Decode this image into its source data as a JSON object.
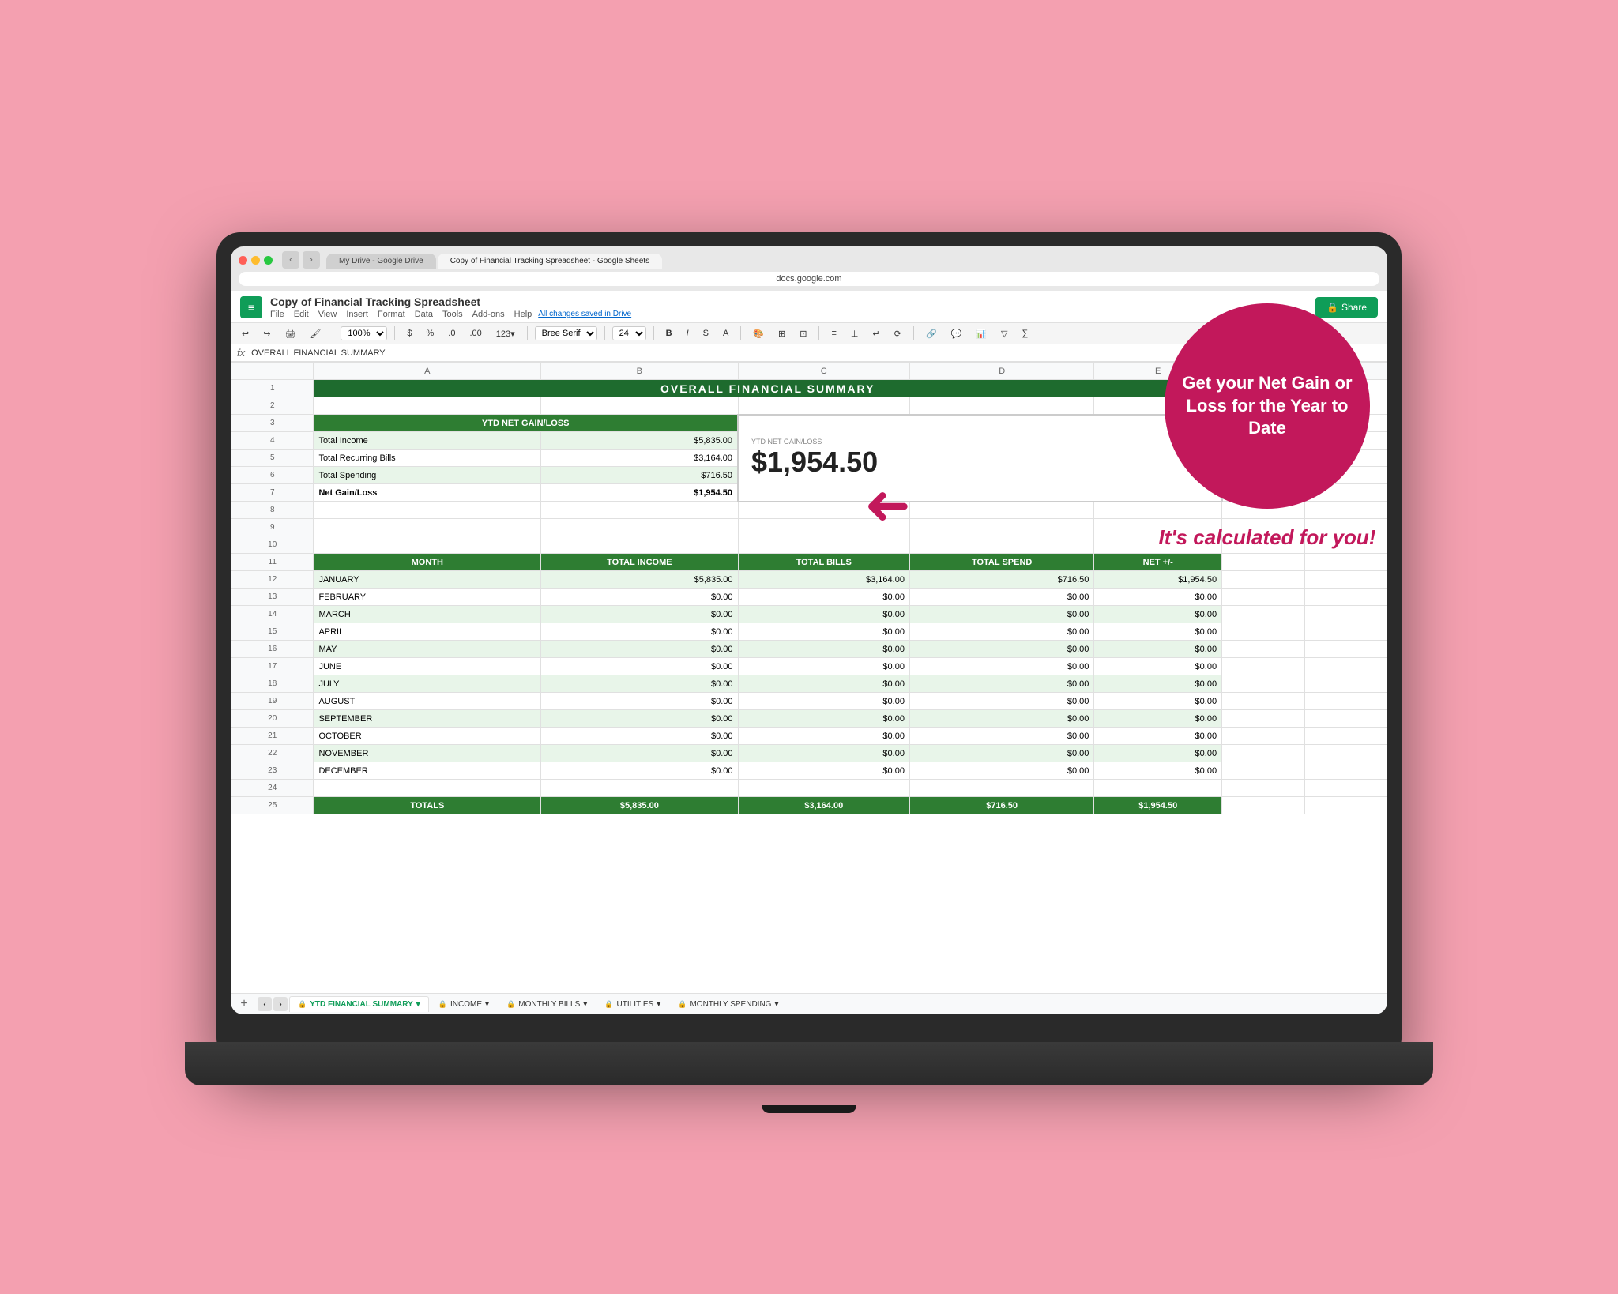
{
  "browser": {
    "url": "docs.google.com",
    "tabs": [
      {
        "label": "My Drive - Google Drive",
        "active": false
      },
      {
        "label": "Copy of Financial Tracking Spreadsheet - Google Sheets",
        "active": true
      }
    ]
  },
  "spreadsheet": {
    "title": "Copy of Financial Tracking Spreadsheet",
    "formula_bar_text": "OVERALL FINANCIAL SUMMARY",
    "autosave_text": "All changes saved in Drive",
    "share_label": "Share",
    "menu_items": [
      "File",
      "Edit",
      "View",
      "Insert",
      "Format",
      "Data",
      "Tools",
      "Add-ons",
      "Help"
    ],
    "header_title": "OVERALL FINANCIAL SUMMARY",
    "ytd_label": "YTD NET GAIN/LOSS",
    "ytd_value": "$1,954.50",
    "rows": [
      {
        "num": 3,
        "label": "YTD NET GAIN/LOSS",
        "value": "",
        "style": "medium-green-header"
      },
      {
        "num": 4,
        "label": "Total Income",
        "value": "$5,835.00",
        "style": "light-green"
      },
      {
        "num": 5,
        "label": "Total Recurring Bills",
        "value": "$3,164.00",
        "style": ""
      },
      {
        "num": 6,
        "label": "Total Spending",
        "value": "$716.50",
        "style": "light-green"
      },
      {
        "num": 7,
        "label": "Net Gain/Loss",
        "value": "$1,954.50",
        "style": "bold"
      }
    ],
    "monthly_headers": [
      "MONTH",
      "TOTAL INCOME",
      "TOTAL BILLS",
      "TOTAL SPEND",
      "NET +/-"
    ],
    "months": [
      {
        "name": "JANUARY",
        "income": "$5,835.00",
        "bills": "$3,164.00",
        "spend": "$716.50",
        "net": "$1,954.50"
      },
      {
        "name": "FEBRUARY",
        "income": "$0.00",
        "bills": "$0.00",
        "spend": "$0.00",
        "net": "$0.00"
      },
      {
        "name": "MARCH",
        "income": "$0.00",
        "bills": "$0.00",
        "spend": "$0.00",
        "net": "$0.00"
      },
      {
        "name": "APRIL",
        "income": "$0.00",
        "bills": "$0.00",
        "spend": "$0.00",
        "net": "$0.00"
      },
      {
        "name": "MAY",
        "income": "$0.00",
        "bills": "$0.00",
        "spend": "$0.00",
        "net": "$0.00"
      },
      {
        "name": "JUNE",
        "income": "$0.00",
        "bills": "$0.00",
        "spend": "$0.00",
        "net": "$0.00"
      },
      {
        "name": "JULY",
        "income": "$0.00",
        "bills": "$0.00",
        "spend": "$0.00",
        "net": "$0.00"
      },
      {
        "name": "AUGUST",
        "income": "$0.00",
        "bills": "$0.00",
        "spend": "$0.00",
        "net": "$0.00"
      },
      {
        "name": "SEPTEMBER",
        "income": "$0.00",
        "bills": "$0.00",
        "spend": "$0.00",
        "net": "$0.00"
      },
      {
        "name": "OCTOBER",
        "income": "$0.00",
        "bills": "$0.00",
        "spend": "$0.00",
        "net": "$0.00"
      },
      {
        "name": "NOVEMBER",
        "income": "$0.00",
        "bills": "$0.00",
        "spend": "$0.00",
        "net": "$0.00"
      },
      {
        "name": "DECEMBER",
        "income": "$0.00",
        "bills": "$0.00",
        "spend": "$0.00",
        "net": "$0.00"
      }
    ],
    "totals": {
      "label": "TOTALS",
      "income": "$5,835.00",
      "bills": "$3,164.00",
      "spend": "$716.50",
      "net": "$1,954.50"
    },
    "tabs": [
      {
        "label": "YTD FINANCIAL SUMMARY",
        "active": true,
        "locked": true
      },
      {
        "label": "INCOME",
        "active": false,
        "locked": true
      },
      {
        "label": "MONTHLY BILLS",
        "active": false,
        "locked": true
      },
      {
        "label": "UTILITIES",
        "active": false,
        "locked": true
      },
      {
        "label": "MONTHLY SPENDING",
        "active": false,
        "locked": true
      }
    ]
  },
  "callout": {
    "circle_text": "Get your Net Gain or Loss for the Year to Date",
    "bottom_text": "It's calculated for you!"
  },
  "colors": {
    "dark_green": "#1e6b2e",
    "medium_green": "#2e7d32",
    "light_green_row": "#e8f5e9",
    "alt_green": "#f1f8e9",
    "pink": "#c2185b",
    "pink_bg": "#f4a0b0"
  }
}
